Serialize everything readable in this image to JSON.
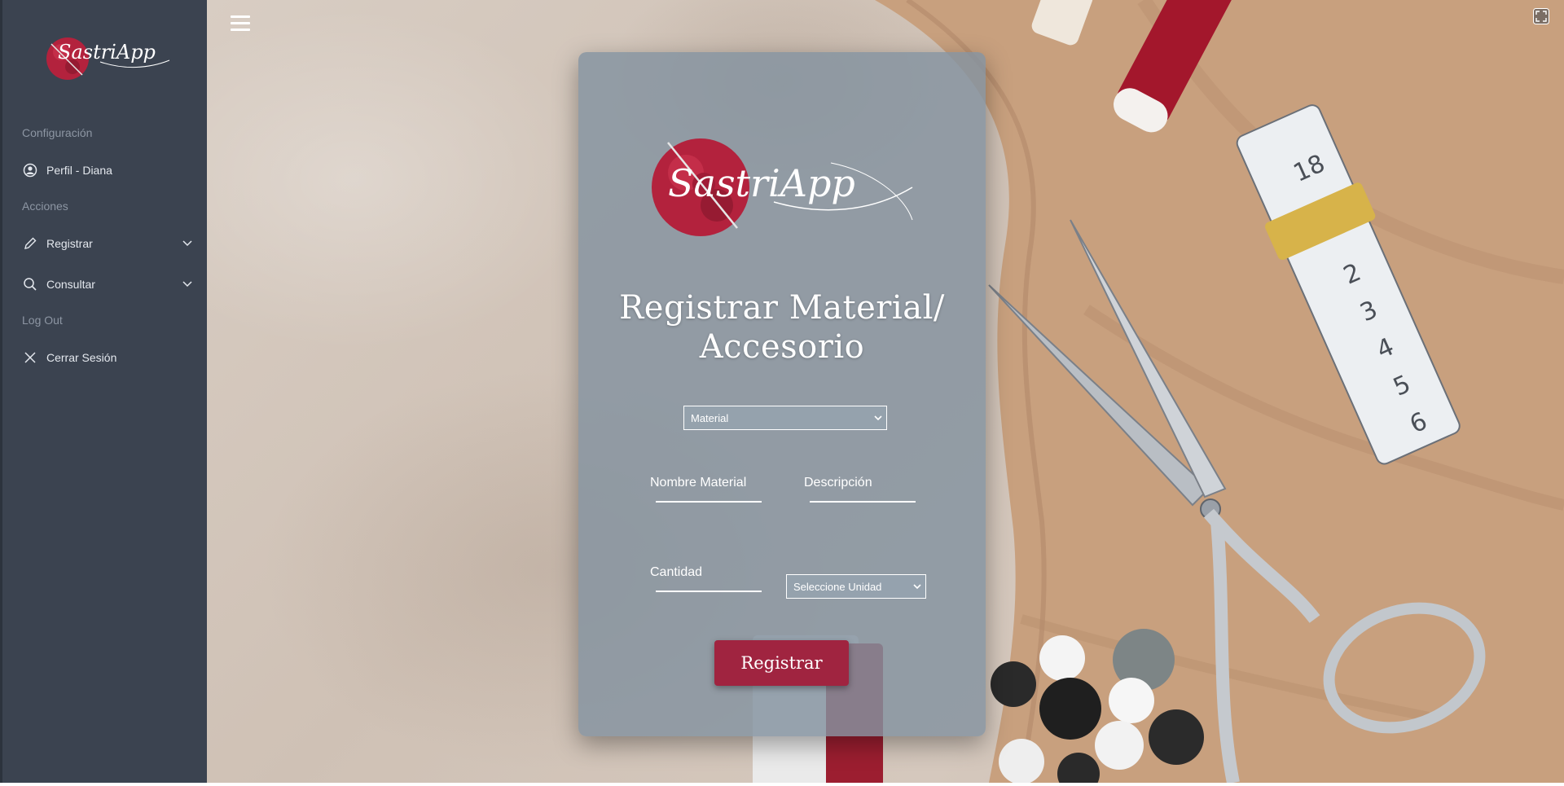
{
  "sidebar": {
    "logo_text": "SastriApp",
    "sections": {
      "config": "Configuración",
      "actions": "Acciones",
      "logout": "Log Out"
    },
    "items": {
      "profile": "Perfil - Diana",
      "register": "Registrar",
      "consult": "Consultar",
      "signout": "Cerrar Sesión"
    }
  },
  "card": {
    "logo_text": "SastriApp",
    "title_line1": "Registrar Material/",
    "title_line2": "Accesorio",
    "type_select": "Material",
    "name_field": "Nombre Material",
    "description_field": "Descripción",
    "quantity_field": "Cantidad",
    "unit_select": "Seleccione Unidad",
    "submit_label": "Registrar"
  },
  "colors": {
    "sidebar_bg": "#3b4350",
    "accent": "#a02440",
    "card_bg": "#84929f"
  }
}
